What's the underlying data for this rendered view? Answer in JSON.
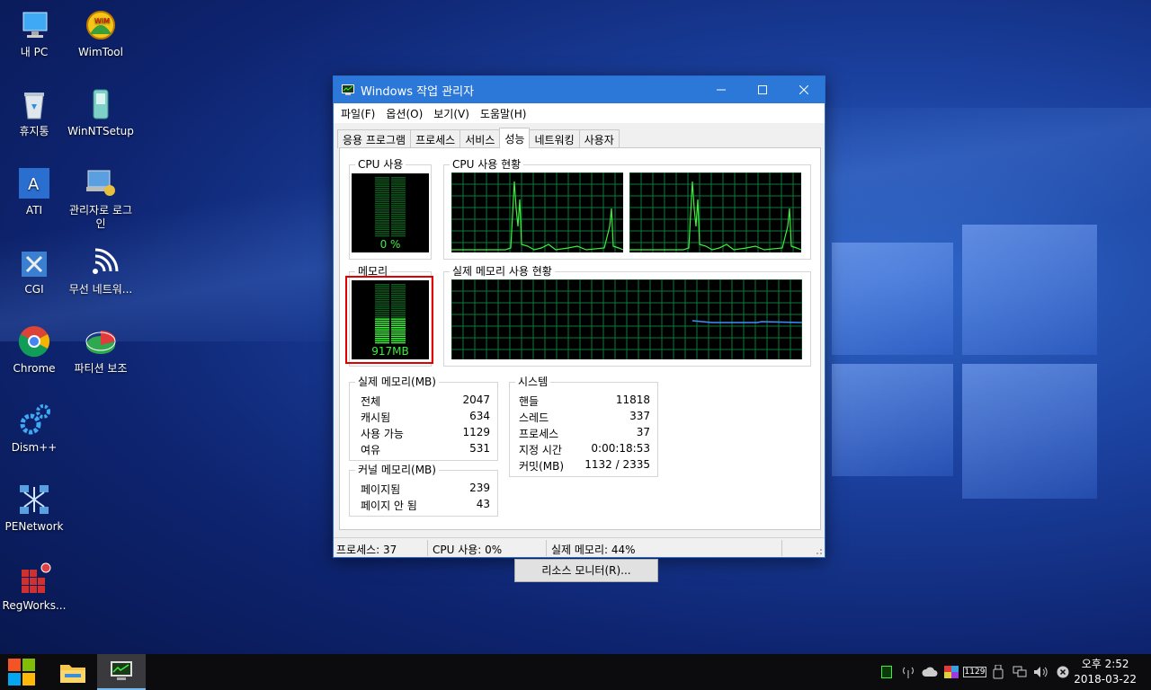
{
  "desktop": {
    "icons": [
      {
        "label": "내 PC"
      },
      {
        "label": "WimTool"
      },
      {
        "label": "휴지통"
      },
      {
        "label": "WinNTSetup"
      },
      {
        "label": "ATI"
      },
      {
        "label": "관리자로 로그인"
      },
      {
        "label": "CGI"
      },
      {
        "label": "무선 네트워..."
      },
      {
        "label": "Chrome"
      },
      {
        "label": "파티션 보조"
      },
      {
        "label": "Dism++"
      },
      {
        "label": "PENetwork"
      },
      {
        "label": "RegWorks..."
      }
    ]
  },
  "window": {
    "title": "Windows 작업 관리자",
    "menu": [
      "파일(F)",
      "옵션(O)",
      "보기(V)",
      "도움말(H)"
    ],
    "tabs": [
      "응용 프로그램",
      "프로세스",
      "서비스",
      "성능",
      "네트워킹",
      "사용자"
    ],
    "active_tab": "성능",
    "cpu_usage": {
      "label": "CPU 사용",
      "value": "0 %"
    },
    "cpu_history": {
      "label": "CPU 사용 현황"
    },
    "memory": {
      "label": "메모리",
      "value": "917MB"
    },
    "memory_history": {
      "label": "실제 메모리 사용 현황"
    },
    "physical_memory": {
      "label": "실제 메모리(MB)",
      "rows": [
        {
          "k": "전체",
          "v": "2047"
        },
        {
          "k": "캐시됨",
          "v": "634"
        },
        {
          "k": "사용 가능",
          "v": "1129"
        },
        {
          "k": "여유",
          "v": "531"
        }
      ]
    },
    "kernel_memory": {
      "label": "커널 메모리(MB)",
      "rows": [
        {
          "k": "페이지됨",
          "v": "239"
        },
        {
          "k": "페이지 안 됨",
          "v": "43"
        }
      ]
    },
    "system": {
      "label": "시스템",
      "rows": [
        {
          "k": "핸들",
          "v": "11818"
        },
        {
          "k": "스레드",
          "v": "337"
        },
        {
          "k": "프로세스",
          "v": "37"
        },
        {
          "k": "지정 시간",
          "v": "0:00:18:53"
        },
        {
          "k": "커밋(MB)",
          "v": "1132 / 2335"
        }
      ]
    },
    "resource_monitor_button": "리소스 모니터(R)...",
    "status": {
      "processes": "프로세스: 37",
      "cpu": "CPU 사용: 0%",
      "memory": "실제 메모리: 44%"
    }
  },
  "taskbar": {
    "clock_time": "오후 2:52",
    "clock_date": "2018-03-22",
    "tray_badge": "1129"
  }
}
